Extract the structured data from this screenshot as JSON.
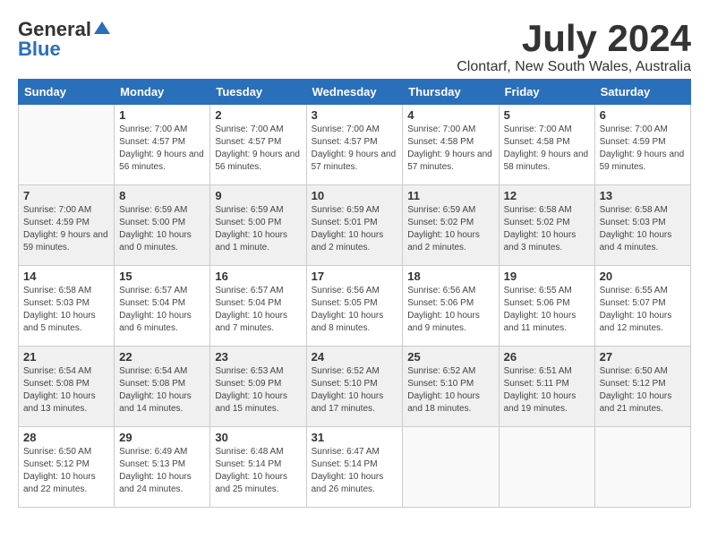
{
  "header": {
    "logo_general": "General",
    "logo_blue": "Blue",
    "month_year": "July 2024",
    "location": "Clontarf, New South Wales, Australia"
  },
  "weekdays": [
    "Sunday",
    "Monday",
    "Tuesday",
    "Wednesday",
    "Thursday",
    "Friday",
    "Saturday"
  ],
  "weeks": [
    [
      {
        "day": "",
        "sunrise": "",
        "sunset": "",
        "daylight": ""
      },
      {
        "day": "1",
        "sunrise": "Sunrise: 7:00 AM",
        "sunset": "Sunset: 4:57 PM",
        "daylight": "Daylight: 9 hours and 56 minutes."
      },
      {
        "day": "2",
        "sunrise": "Sunrise: 7:00 AM",
        "sunset": "Sunset: 4:57 PM",
        "daylight": "Daylight: 9 hours and 56 minutes."
      },
      {
        "day": "3",
        "sunrise": "Sunrise: 7:00 AM",
        "sunset": "Sunset: 4:57 PM",
        "daylight": "Daylight: 9 hours and 57 minutes."
      },
      {
        "day": "4",
        "sunrise": "Sunrise: 7:00 AM",
        "sunset": "Sunset: 4:58 PM",
        "daylight": "Daylight: 9 hours and 57 minutes."
      },
      {
        "day": "5",
        "sunrise": "Sunrise: 7:00 AM",
        "sunset": "Sunset: 4:58 PM",
        "daylight": "Daylight: 9 hours and 58 minutes."
      },
      {
        "day": "6",
        "sunrise": "Sunrise: 7:00 AM",
        "sunset": "Sunset: 4:59 PM",
        "daylight": "Daylight: 9 hours and 59 minutes."
      }
    ],
    [
      {
        "day": "7",
        "sunrise": "Sunrise: 7:00 AM",
        "sunset": "Sunset: 4:59 PM",
        "daylight": "Daylight: 9 hours and 59 minutes."
      },
      {
        "day": "8",
        "sunrise": "Sunrise: 6:59 AM",
        "sunset": "Sunset: 5:00 PM",
        "daylight": "Daylight: 10 hours and 0 minutes."
      },
      {
        "day": "9",
        "sunrise": "Sunrise: 6:59 AM",
        "sunset": "Sunset: 5:00 PM",
        "daylight": "Daylight: 10 hours and 1 minute."
      },
      {
        "day": "10",
        "sunrise": "Sunrise: 6:59 AM",
        "sunset": "Sunset: 5:01 PM",
        "daylight": "Daylight: 10 hours and 2 minutes."
      },
      {
        "day": "11",
        "sunrise": "Sunrise: 6:59 AM",
        "sunset": "Sunset: 5:02 PM",
        "daylight": "Daylight: 10 hours and 2 minutes."
      },
      {
        "day": "12",
        "sunrise": "Sunrise: 6:58 AM",
        "sunset": "Sunset: 5:02 PM",
        "daylight": "Daylight: 10 hours and 3 minutes."
      },
      {
        "day": "13",
        "sunrise": "Sunrise: 6:58 AM",
        "sunset": "Sunset: 5:03 PM",
        "daylight": "Daylight: 10 hours and 4 minutes."
      }
    ],
    [
      {
        "day": "14",
        "sunrise": "Sunrise: 6:58 AM",
        "sunset": "Sunset: 5:03 PM",
        "daylight": "Daylight: 10 hours and 5 minutes."
      },
      {
        "day": "15",
        "sunrise": "Sunrise: 6:57 AM",
        "sunset": "Sunset: 5:04 PM",
        "daylight": "Daylight: 10 hours and 6 minutes."
      },
      {
        "day": "16",
        "sunrise": "Sunrise: 6:57 AM",
        "sunset": "Sunset: 5:04 PM",
        "daylight": "Daylight: 10 hours and 7 minutes."
      },
      {
        "day": "17",
        "sunrise": "Sunrise: 6:56 AM",
        "sunset": "Sunset: 5:05 PM",
        "daylight": "Daylight: 10 hours and 8 minutes."
      },
      {
        "day": "18",
        "sunrise": "Sunrise: 6:56 AM",
        "sunset": "Sunset: 5:06 PM",
        "daylight": "Daylight: 10 hours and 9 minutes."
      },
      {
        "day": "19",
        "sunrise": "Sunrise: 6:55 AM",
        "sunset": "Sunset: 5:06 PM",
        "daylight": "Daylight: 10 hours and 11 minutes."
      },
      {
        "day": "20",
        "sunrise": "Sunrise: 6:55 AM",
        "sunset": "Sunset: 5:07 PM",
        "daylight": "Daylight: 10 hours and 12 minutes."
      }
    ],
    [
      {
        "day": "21",
        "sunrise": "Sunrise: 6:54 AM",
        "sunset": "Sunset: 5:08 PM",
        "daylight": "Daylight: 10 hours and 13 minutes."
      },
      {
        "day": "22",
        "sunrise": "Sunrise: 6:54 AM",
        "sunset": "Sunset: 5:08 PM",
        "daylight": "Daylight: 10 hours and 14 minutes."
      },
      {
        "day": "23",
        "sunrise": "Sunrise: 6:53 AM",
        "sunset": "Sunset: 5:09 PM",
        "daylight": "Daylight: 10 hours and 15 minutes."
      },
      {
        "day": "24",
        "sunrise": "Sunrise: 6:52 AM",
        "sunset": "Sunset: 5:10 PM",
        "daylight": "Daylight: 10 hours and 17 minutes."
      },
      {
        "day": "25",
        "sunrise": "Sunrise: 6:52 AM",
        "sunset": "Sunset: 5:10 PM",
        "daylight": "Daylight: 10 hours and 18 minutes."
      },
      {
        "day": "26",
        "sunrise": "Sunrise: 6:51 AM",
        "sunset": "Sunset: 5:11 PM",
        "daylight": "Daylight: 10 hours and 19 minutes."
      },
      {
        "day": "27",
        "sunrise": "Sunrise: 6:50 AM",
        "sunset": "Sunset: 5:12 PM",
        "daylight": "Daylight: 10 hours and 21 minutes."
      }
    ],
    [
      {
        "day": "28",
        "sunrise": "Sunrise: 6:50 AM",
        "sunset": "Sunset: 5:12 PM",
        "daylight": "Daylight: 10 hours and 22 minutes."
      },
      {
        "day": "29",
        "sunrise": "Sunrise: 6:49 AM",
        "sunset": "Sunset: 5:13 PM",
        "daylight": "Daylight: 10 hours and 24 minutes."
      },
      {
        "day": "30",
        "sunrise": "Sunrise: 6:48 AM",
        "sunset": "Sunset: 5:14 PM",
        "daylight": "Daylight: 10 hours and 25 minutes."
      },
      {
        "day": "31",
        "sunrise": "Sunrise: 6:47 AM",
        "sunset": "Sunset: 5:14 PM",
        "daylight": "Daylight: 10 hours and 26 minutes."
      },
      {
        "day": "",
        "sunrise": "",
        "sunset": "",
        "daylight": ""
      },
      {
        "day": "",
        "sunrise": "",
        "sunset": "",
        "daylight": ""
      },
      {
        "day": "",
        "sunrise": "",
        "sunset": "",
        "daylight": ""
      }
    ]
  ]
}
